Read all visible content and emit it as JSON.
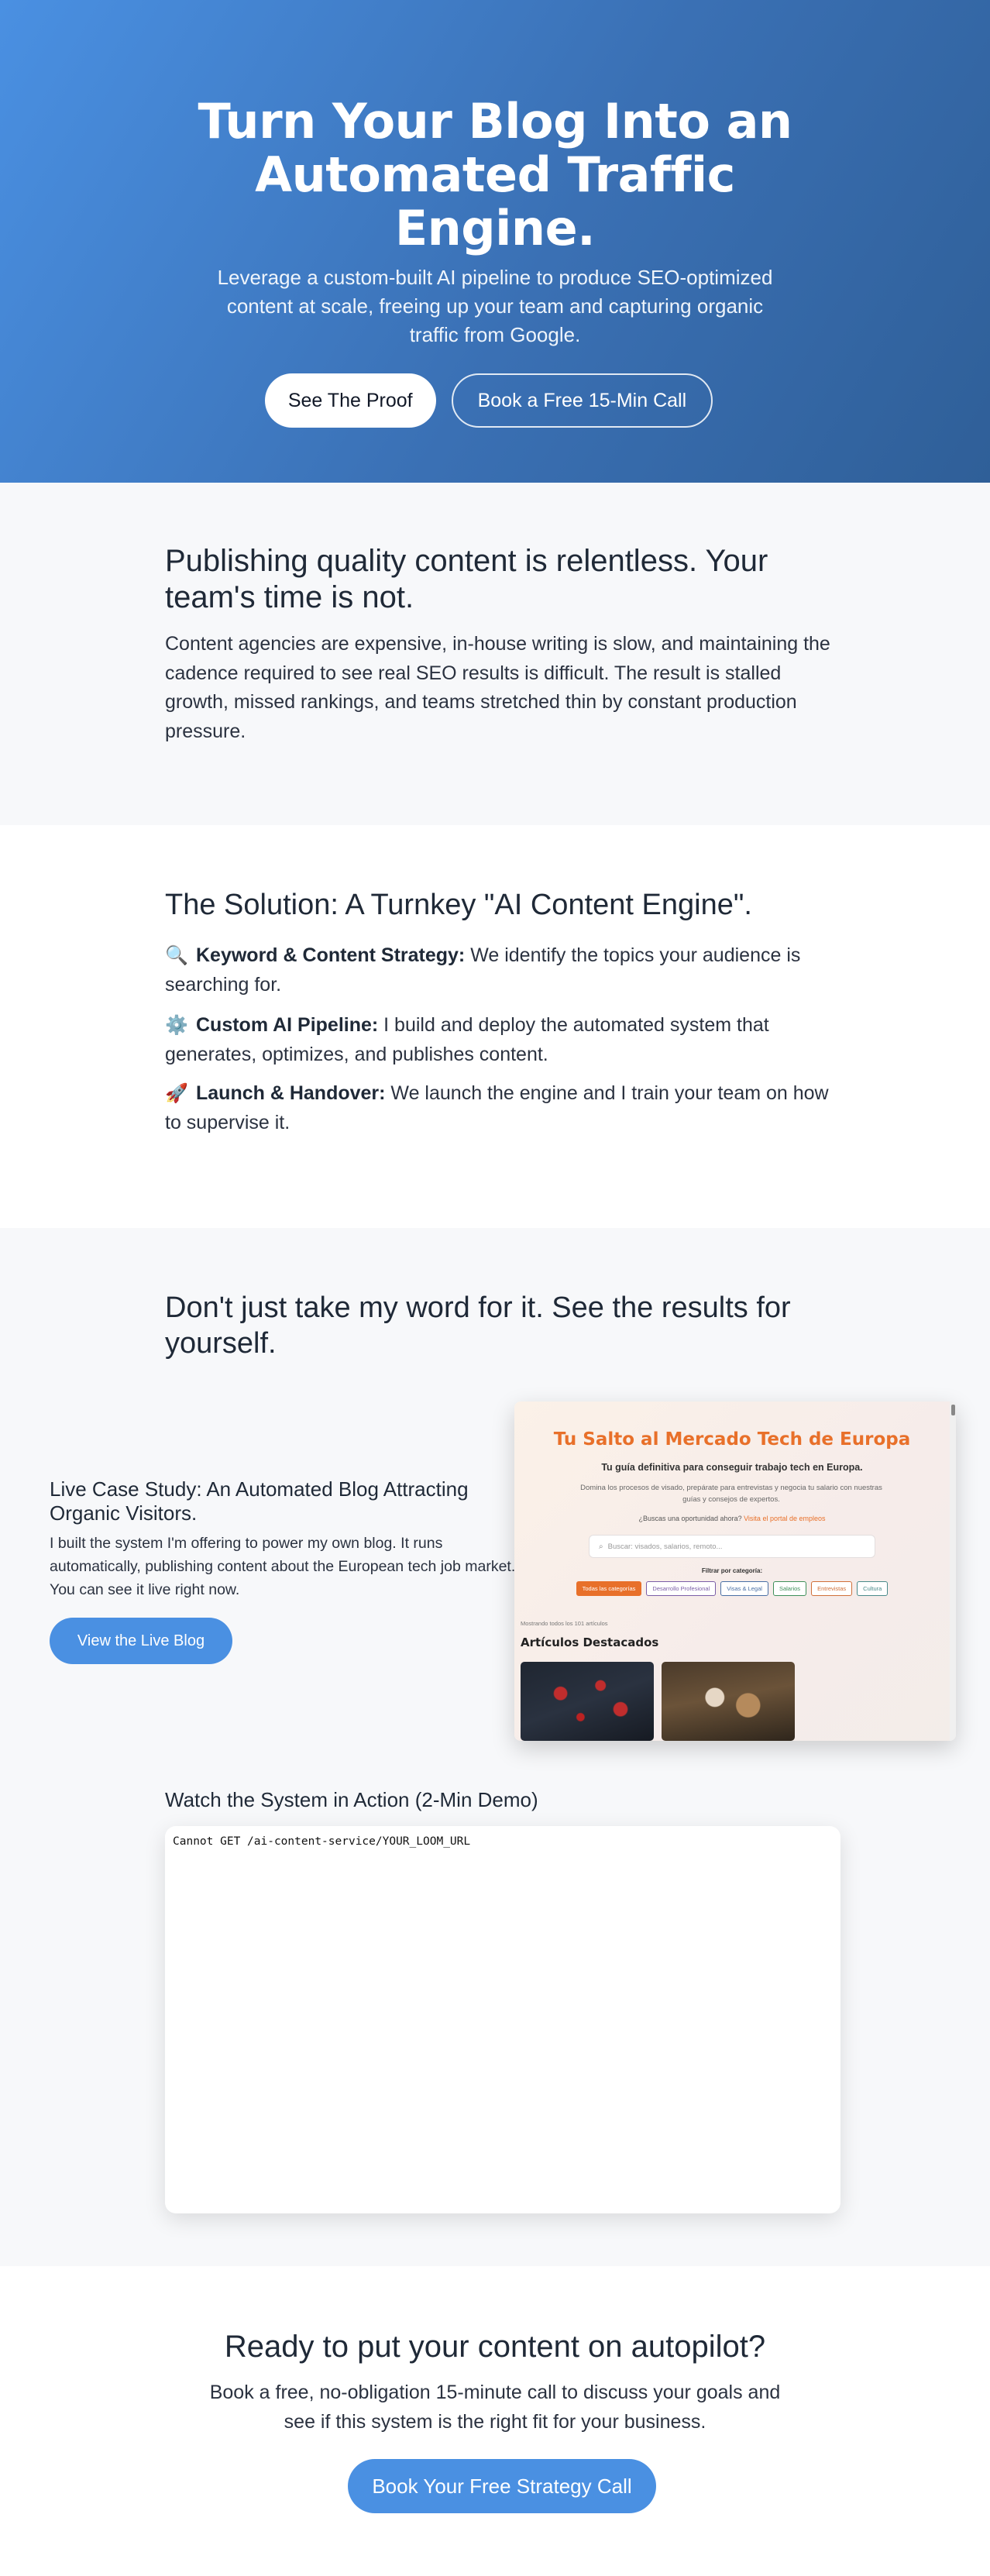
{
  "hero": {
    "title": "Turn Your Blog Into an Automated Traffic Engine.",
    "subtitle": "Leverage a custom-built AI pipeline to produce SEO-optimized content at scale, freeing up your team and capturing organic traffic from Google.",
    "primary_button": "See The Proof",
    "secondary_button": "Book a Free 15-Min Call"
  },
  "problem": {
    "heading": "Publishing quality content is relentless. Your team's time is not.",
    "body": "Content agencies are expensive, in-house writing is slow, and maintaining the cadence required to see real SEO results is difficult. The result is stalled growth, missed rankings, and teams stretched thin by constant production pressure."
  },
  "solution": {
    "heading": "The Solution: A Turnkey \"AI Content Engine\".",
    "items": [
      {
        "icon": "magnifier-icon",
        "glyph": "🔍",
        "title": "Keyword & Content Strategy:",
        "text": " We identify the topics your audience is searching for."
      },
      {
        "icon": "gear-icon",
        "glyph": "⚙️",
        "title": "Custom AI Pipeline:",
        "text": " I build and deploy the automated system that generates, optimizes, and publishes content."
      },
      {
        "icon": "rocket-icon",
        "glyph": "🚀",
        "title": "Launch & Handover:",
        "text": " We launch the engine and I train your team on how to supervise it."
      }
    ]
  },
  "proof": {
    "heading": "Don't just take my word for it. See the results for yourself.",
    "case_title": "Live Case Study: An Automated Blog Attracting Organic Visitors.",
    "case_description": "I built the system I'm offering to power my own blog. It runs automatically, publishing content about the European tech job market. You can see it live right now.",
    "case_button": "View the Live Blog",
    "screenshot": {
      "title": "Tu Salto al Mercado Tech de Europa",
      "subtitle": "Tu guía definitiva para conseguir trabajo tech en Europa.",
      "description": "Domina los procesos de visado, prepárate para entrevistas y negocia tu salario con nuestras guías y consejos de expertos.",
      "question": "¿Buscas una oportunidad ahora?",
      "question_link": "Visita el portal de empleos",
      "search_placeholder": "Buscar: visados, salarios, remoto...",
      "filter_label": "Filtrar por categoría:",
      "categories": [
        {
          "label": "Todas las categorías",
          "color": "#e8702a",
          "active": true
        },
        {
          "label": "Desarrollo Profesional",
          "color": "#7b5ea7",
          "active": false
        },
        {
          "label": "Visas & Legal",
          "color": "#4a6fa5",
          "active": false
        },
        {
          "label": "Salarios",
          "color": "#3f8f5a",
          "active": false
        },
        {
          "label": "Entrevistas",
          "color": "#d0703a",
          "active": false
        },
        {
          "label": "Cultura",
          "color": "#4a8a8a",
          "active": false
        }
      ],
      "count_text": "Mostrando todos los 101 artículos",
      "featured_label": "Artículos Destacados"
    },
    "demo_title": "Watch the System in Action (2-Min Demo)",
    "demo_error": "Cannot GET /ai-content-service/YOUR_LOOM_URL"
  },
  "cta": {
    "heading": "Ready to put your content on autopilot?",
    "body": "Book a free, no-obligation 15-minute call to discuss your goals and see if this system is the right fit for your business.",
    "button": "Book Your Free Strategy Call"
  },
  "colors": {
    "accent_blue": "#4a90e2",
    "hero_gradient_end": "#2f5f98",
    "orange": "#e8702a"
  }
}
